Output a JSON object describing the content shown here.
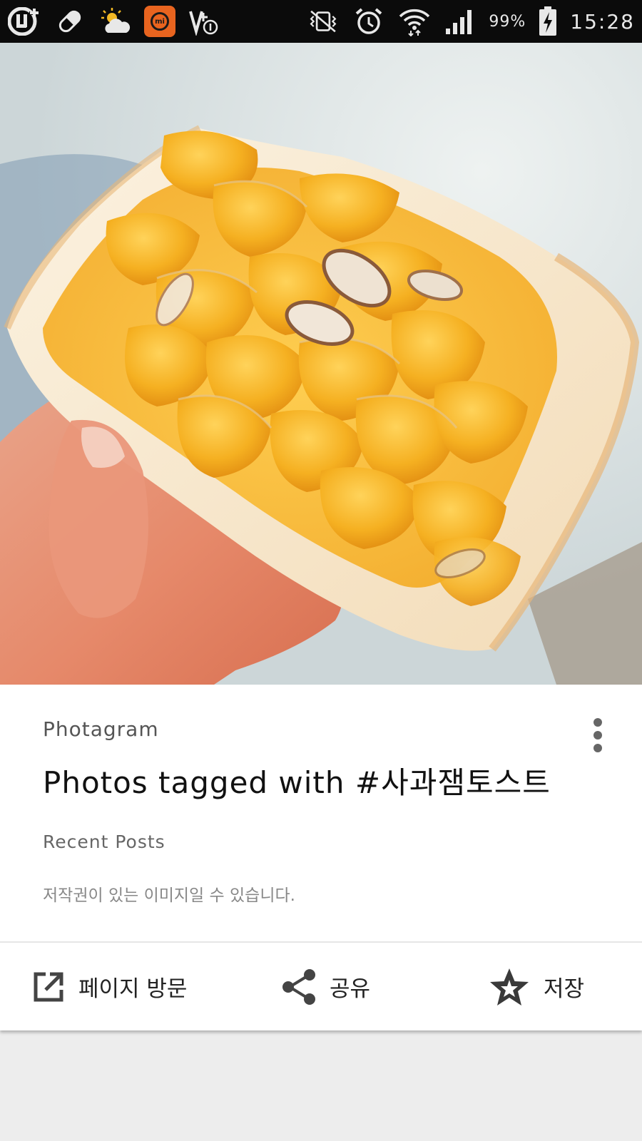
{
  "status_bar": {
    "left_icons": [
      "uplus-icon",
      "pill-icon",
      "partly-cloudy-icon",
      "mi-icon",
      "volte-icon"
    ],
    "mi_label": "mi",
    "right_icons": [
      "vibrate-icon",
      "alarm-icon",
      "wifi-icon",
      "signal-icon",
      "battery-charging-icon"
    ],
    "battery": "99%",
    "time": "15:28"
  },
  "hero_image": {
    "subject": "hand holding toast with cornflakes and almonds",
    "icon": "photo"
  },
  "card": {
    "source": "Photagram",
    "title": "Photos tagged with #사과잼토스트",
    "subtitle": "Recent Posts",
    "note": "저작권이 있는 이미지일 수 있습니다.",
    "more_icon": "more-vert-icon"
  },
  "actions": {
    "visit_label": "페이지 방문",
    "share_label": "공유",
    "save_label": "저장"
  },
  "colors": {
    "status_bar_bg": "#0b0b0b",
    "card_bg": "#ffffff",
    "page_bg": "#ededed",
    "mi_orange": "#e8641f"
  }
}
